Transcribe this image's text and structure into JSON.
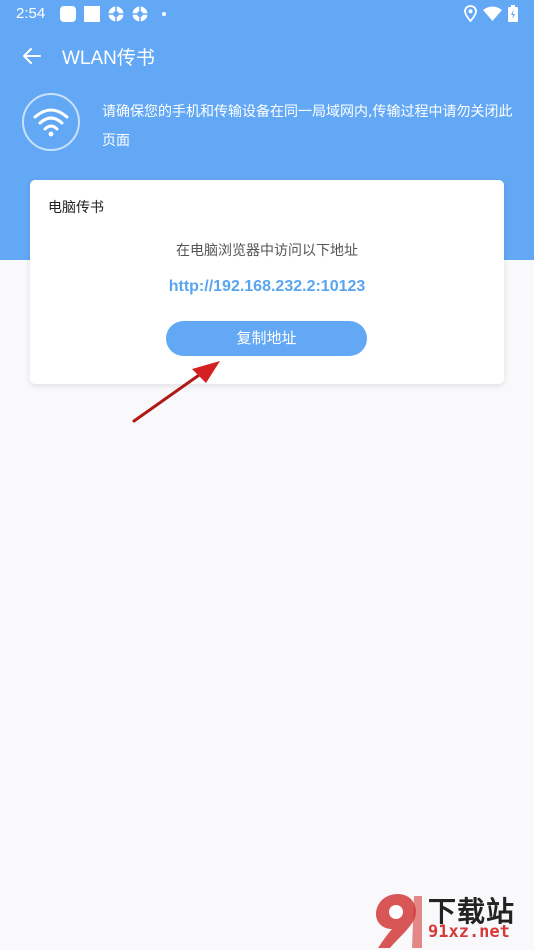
{
  "status_bar": {
    "time": "2:54",
    "left_icons": [
      "app-icon",
      "app-icon",
      "settings-icon",
      "settings-icon",
      "dot-icon"
    ],
    "right_icons": [
      "location-icon",
      "wifi-icon",
      "battery-icon"
    ]
  },
  "app_bar": {
    "title": "WLAN传书",
    "back_icon": "arrow-left-icon"
  },
  "notice": {
    "icon": "wifi-icon",
    "text": "请确保您的手机和传输设备在同一局域网内,传输过程中请勿关闭此页面"
  },
  "card": {
    "title": "电脑传书",
    "subtitle": "在电脑浏览器中访问以下地址",
    "url": "http://192.168.232.2:10123",
    "copy_button": "复制地址"
  },
  "watermark": {
    "big": "下载站",
    "small": "91xz.net"
  },
  "colors": {
    "primary": "#63a8f5",
    "url": "#5aa5f0",
    "background": "#f9f9fb",
    "annotation_arrow": "#d42020"
  }
}
